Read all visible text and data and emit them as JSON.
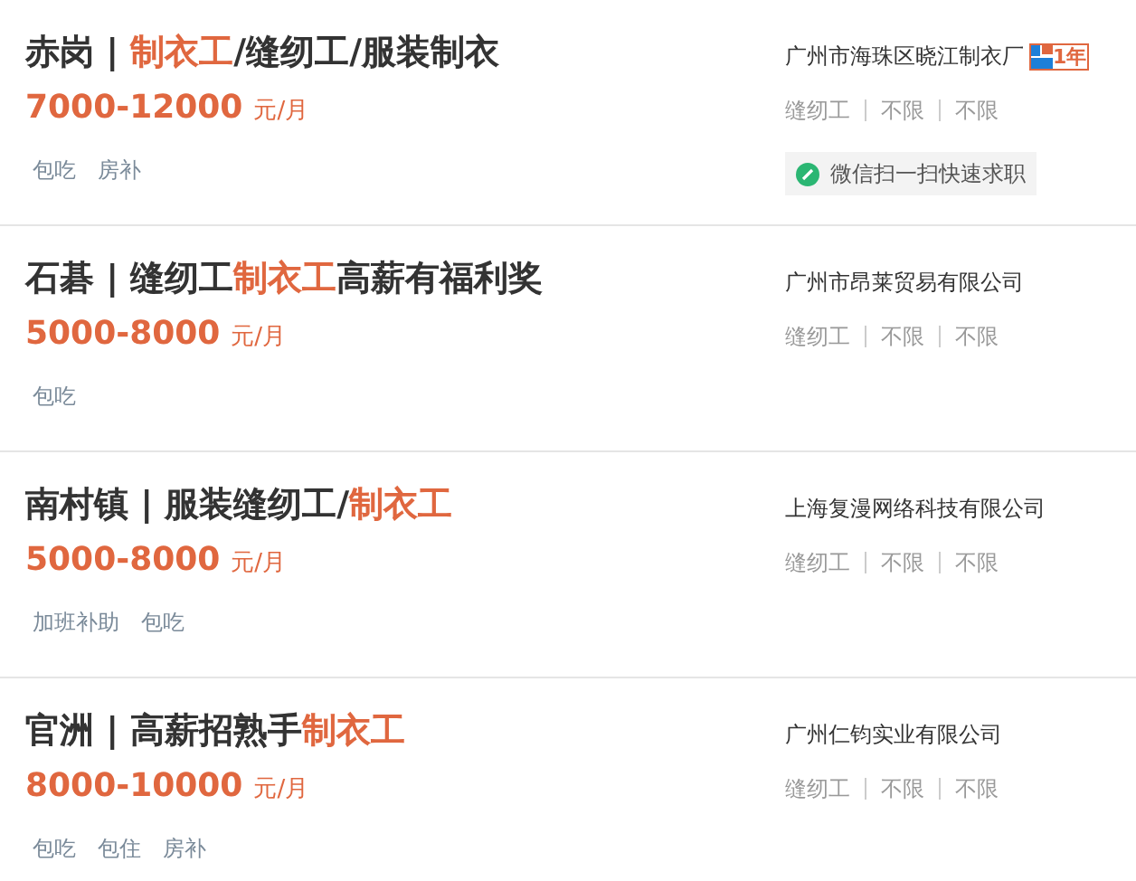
{
  "jobs": [
    {
      "title": [
        {
          "text": "赤岗 | ",
          "highlight": false
        },
        {
          "text": "制衣工",
          "highlight": true
        },
        {
          "text": "/缝纫工/服装制衣",
          "highlight": false
        }
      ],
      "salary": "7000-12000",
      "unit": "元/月",
      "benefits": [
        "包吃",
        "房补"
      ],
      "company": "广州市海珠区晓江制衣厂",
      "badge": "1年",
      "meta": [
        "缝纫工",
        "不限",
        "不限"
      ],
      "wechat": "微信扫一扫快速求职"
    },
    {
      "title": [
        {
          "text": "石碁 | 缝纫工",
          "highlight": false
        },
        {
          "text": "制衣工",
          "highlight": true
        },
        {
          "text": "高薪有福利奖",
          "highlight": false
        }
      ],
      "salary": "5000-8000",
      "unit": "元/月",
      "benefits": [
        "包吃"
      ],
      "company": "广州市昂莱贸易有限公司",
      "meta": [
        "缝纫工",
        "不限",
        "不限"
      ]
    },
    {
      "title": [
        {
          "text": "南村镇 | 服装缝纫工/",
          "highlight": false
        },
        {
          "text": "制衣工",
          "highlight": true
        }
      ],
      "salary": "5000-8000",
      "unit": "元/月",
      "benefits": [
        "加班补助",
        "包吃"
      ],
      "company": "上海复漫网络科技有限公司",
      "meta": [
        "缝纫工",
        "不限",
        "不限"
      ]
    },
    {
      "title": [
        {
          "text": "官洲 | 高薪招熟手",
          "highlight": false
        },
        {
          "text": "制衣工",
          "highlight": true
        }
      ],
      "salary": "8000-10000",
      "unit": "元/月",
      "benefits": [
        "包吃",
        "包住",
        "房补"
      ],
      "company": "广州仁钧实业有限公司",
      "meta": [
        "缝纫工",
        "不限",
        "不限"
      ]
    }
  ]
}
